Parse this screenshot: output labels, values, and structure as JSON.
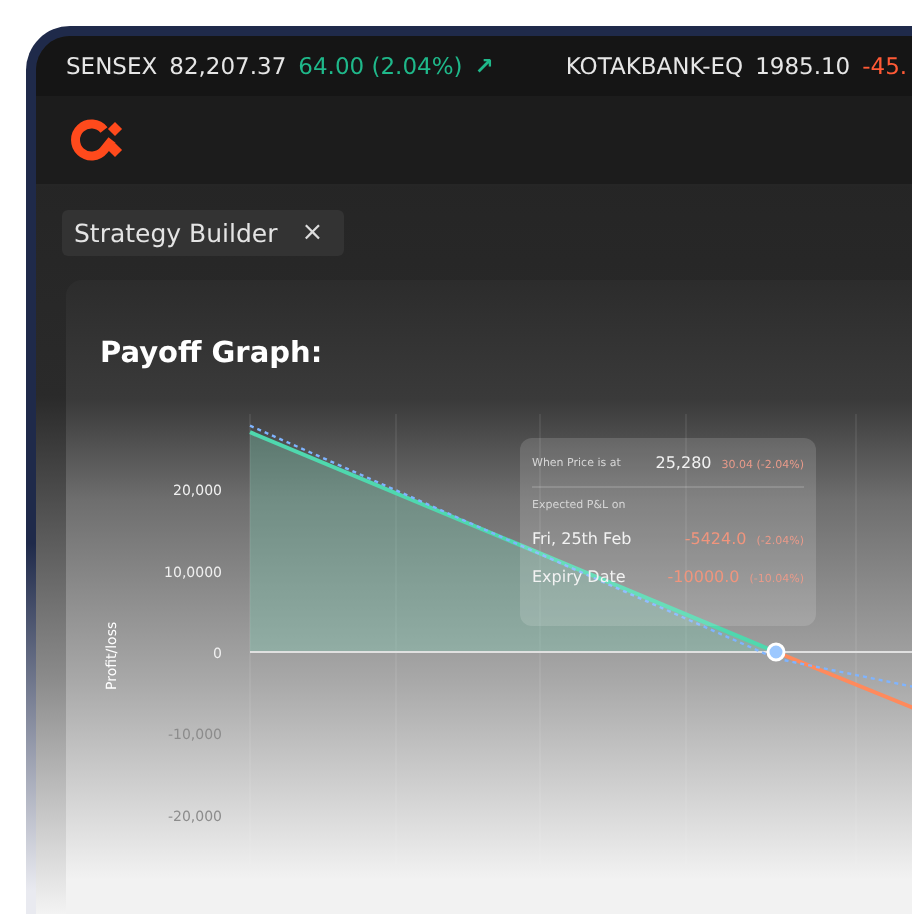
{
  "ticker": [
    {
      "symbol": "SENSEX",
      "price": "82,207.37",
      "change": "64.00 (2.04%)",
      "color": "#1fb88a",
      "arrow": "↗"
    },
    {
      "symbol": "KOTAKBANK-EQ",
      "price": "1985.10",
      "change": "-45.",
      "color": "#ff5a36"
    }
  ],
  "tabs": [
    {
      "label": "Strategy Builder",
      "close": "×",
      "selected": true
    }
  ],
  "card": {
    "title": "Payoff Graph:",
    "chart": {
      "ylabel": "Profit/loss",
      "yticks": [
        "20,000",
        "10,0000",
        "0",
        "-10,000",
        "-20,000"
      ]
    },
    "tooltip": {
      "price_label": "When Price is at",
      "price": "25,280",
      "price_change": "30.04 (-2.04%)",
      "pnl_label": "Expected P&L on",
      "rows": [
        {
          "label": "Fri, 25th Feb",
          "value": "-5424.0",
          "change": "(-2.04%)"
        },
        {
          "label": "Expiry Date",
          "value": "-10000.0",
          "change": "(-10.04%)"
        }
      ]
    }
  }
}
